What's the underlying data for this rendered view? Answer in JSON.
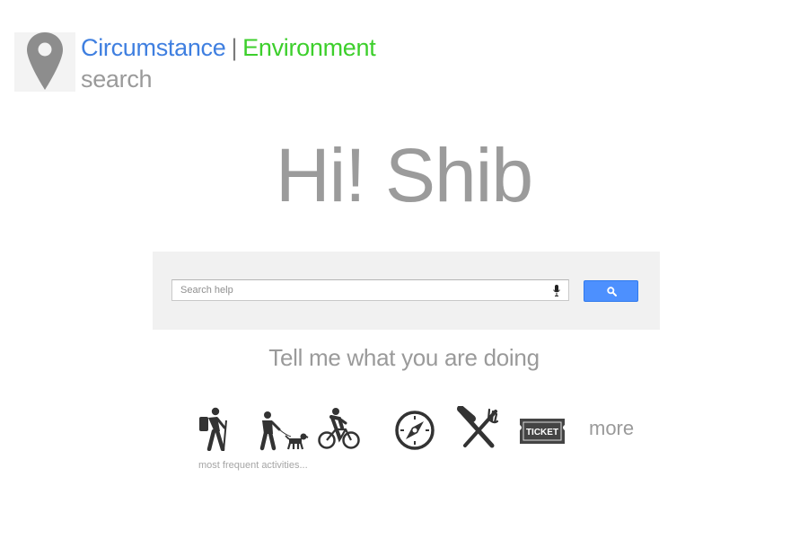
{
  "header": {
    "brand_word_1": "Circumstance",
    "brand_separator": "|",
    "brand_word_2": "Environment",
    "brand_sub": "search",
    "logo_icon": "map-pin-icon",
    "colors": {
      "word_1": "#3f7fe0",
      "word_2": "#3dcf2c",
      "logo_pin": "#8d8d8d"
    }
  },
  "greeting": "Hi! Shib",
  "search": {
    "placeholder": "Search help",
    "value": "",
    "mic_icon": "microphone-icon",
    "button_icon": "magnifier-icon",
    "button_color": "#4d90fe"
  },
  "prompt": "Tell me what you are doing",
  "activities": {
    "items": [
      {
        "name": "hiking",
        "icon": "hiker-icon"
      },
      {
        "name": "dog-walking",
        "icon": "dog-walker-icon"
      },
      {
        "name": "cycling",
        "icon": "cyclist-icon"
      },
      {
        "name": "navigation",
        "icon": "compass-icon"
      },
      {
        "name": "dining",
        "icon": "fork-knife-icon"
      },
      {
        "name": "event",
        "icon": "ticket-icon",
        "label": "TICKET"
      }
    ],
    "more_label": "more",
    "caption": "most frequent activities..."
  }
}
